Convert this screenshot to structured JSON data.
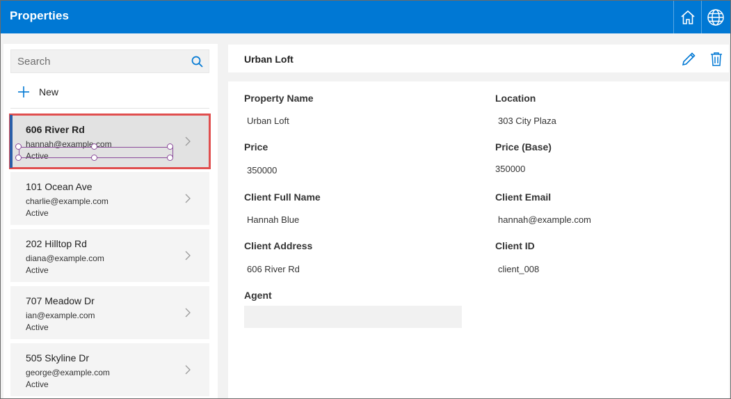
{
  "app": {
    "title": "Properties"
  },
  "topbar": {
    "icons": [
      "home-icon",
      "globe-icon"
    ]
  },
  "search": {
    "placeholder": "Search",
    "value": ""
  },
  "new_button": {
    "label": "New"
  },
  "list": [
    {
      "title": "606 River Rd",
      "email": "hannah@example.com",
      "status": "Active",
      "selected": true
    },
    {
      "title": "101 Ocean Ave",
      "email": "charlie@example.com",
      "status": "Active",
      "selected": false
    },
    {
      "title": "202 Hilltop Rd",
      "email": "diana@example.com",
      "status": "Active",
      "selected": false
    },
    {
      "title": "707 Meadow Dr",
      "email": "ian@example.com",
      "status": "Active",
      "selected": false
    },
    {
      "title": "505 Skyline Dr",
      "email": "george@example.com",
      "status": "Active",
      "selected": false
    }
  ],
  "detail": {
    "title": "Urban Loft",
    "fields": {
      "property_name": {
        "label": "Property Name",
        "value": "Urban Loft"
      },
      "location": {
        "label": "Location",
        "value": "303 City Plaza"
      },
      "price": {
        "label": "Price",
        "value": "350000"
      },
      "price_base": {
        "label": "Price (Base)",
        "value": "350000"
      },
      "client_full_name": {
        "label": "Client Full Name",
        "value": "Hannah Blue"
      },
      "client_email": {
        "label": "Client Email",
        "value": "hannah@example.com"
      },
      "client_address": {
        "label": "Client Address",
        "value": "606 River Rd"
      },
      "client_id": {
        "label": "Client ID",
        "value": "client_008"
      },
      "agent": {
        "label": "Agent",
        "value": ""
      }
    }
  },
  "colors": {
    "topbar": "#0078d4",
    "accent": "#0078d4",
    "selection_outline": "#e04e4e",
    "selection_handles": "#8a4b9a"
  }
}
